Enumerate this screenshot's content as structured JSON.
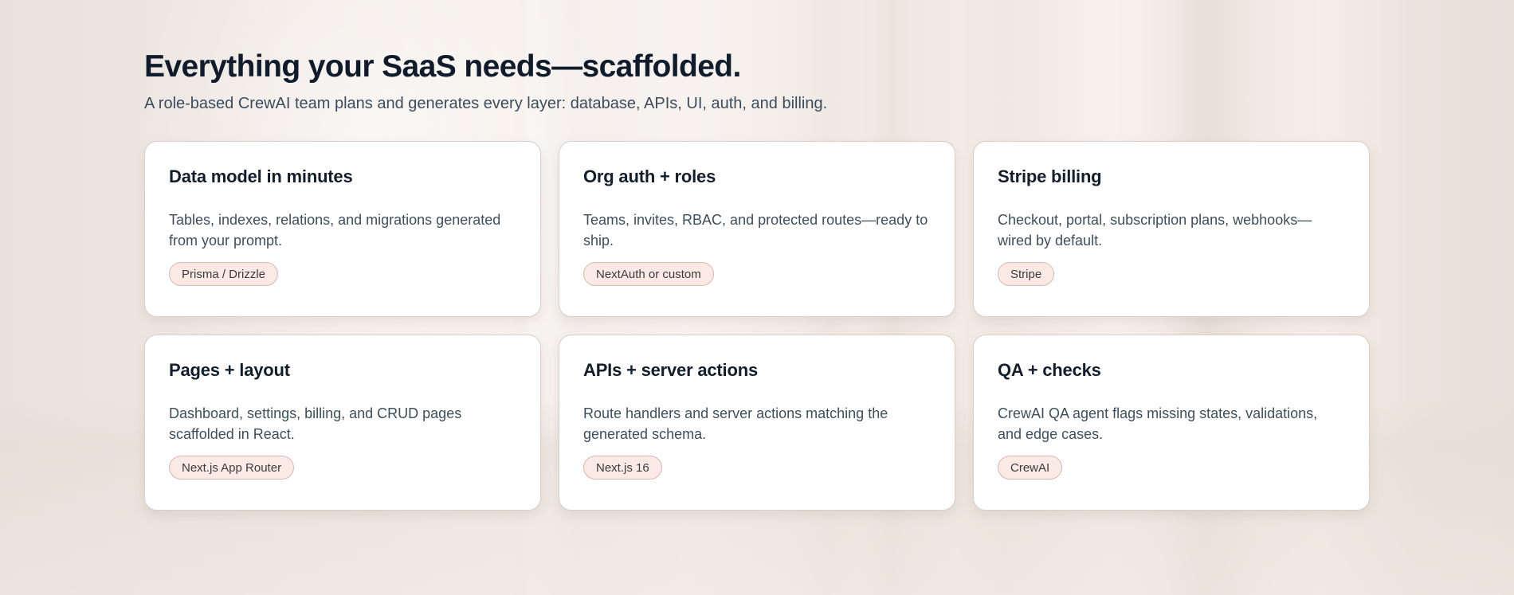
{
  "hero": {
    "title": "Everything your SaaS needs—scaffolded.",
    "subtitle": "A role-based CrewAI team plans and generates every layer: database, APIs, UI, auth, and billing."
  },
  "features": [
    {
      "title": "Data model in minutes",
      "description": "Tables, indexes, relations, and migrations generated from your prompt.",
      "tag": "Prisma / Drizzle"
    },
    {
      "title": "Org auth + roles",
      "description": "Teams, invites, RBAC, and protected routes—ready to ship.",
      "tag": "NextAuth or custom"
    },
    {
      "title": "Stripe billing",
      "description": "Checkout, portal, subscription plans, webhooks—wired by default.",
      "tag": "Stripe"
    },
    {
      "title": "Pages + layout",
      "description": "Dashboard, settings, billing, and CRUD pages scaffolded in React.",
      "tag": "Next.js App Router"
    },
    {
      "title": "APIs + server actions",
      "description": "Route handlers and server actions matching the generated schema.",
      "tag": "Next.js 16"
    },
    {
      "title": "QA + checks",
      "description": "CrewAI QA agent flags missing states, validations, and edge cases.",
      "tag": "CrewAI"
    }
  ],
  "colors": {
    "heading": "#101c2c",
    "body_text": "#3d4f5d",
    "card_background": "#ffffff",
    "tag_background": "#fbe9e6",
    "tag_border": "#d7b8b3"
  }
}
